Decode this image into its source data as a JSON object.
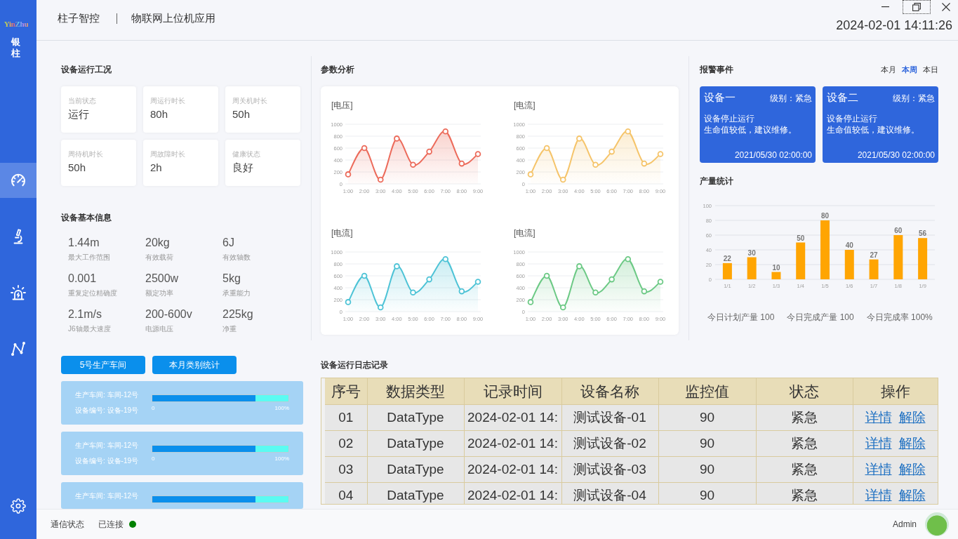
{
  "sidebar": {
    "logo": "YinZhu",
    "brand": "银柱",
    "nav": [
      {
        "kind": "gauge",
        "selected": true
      },
      {
        "kind": "microscope",
        "selected": false
      },
      {
        "kind": "siren",
        "selected": false
      },
      {
        "kind": "path",
        "selected": false
      }
    ]
  },
  "header": {
    "company": "柱子智控",
    "app_title": "物联网上位机应用",
    "datetime": "2024-02-01 14:11:26"
  },
  "window_controls": [
    {
      "kind": "minimize",
      "focused": false
    },
    {
      "kind": "restore",
      "focused": true
    },
    {
      "kind": "close",
      "focused": false
    }
  ],
  "status_panel": {
    "title": "设备运行工况",
    "cards": [
      {
        "label": "当前状态",
        "value": "运行"
      },
      {
        "label": "周运行时长",
        "value": "80h"
      },
      {
        "label": "周关机时长",
        "value": "50h"
      },
      {
        "label": "周待机时长",
        "value": "50h"
      },
      {
        "label": "周故障时长",
        "value": "2h"
      },
      {
        "label": "健康状态",
        "value": "良好"
      }
    ]
  },
  "basic_info": {
    "title": "设备基本信息",
    "items": [
      {
        "value": "1.44m",
        "label": "最大工作范围"
      },
      {
        "value": "20kg",
        "label": "有效载荷"
      },
      {
        "value": "6J",
        "label": "有效轴数"
      },
      {
        "value": "0.001",
        "label": "重复定位精确度"
      },
      {
        "value": "2500w",
        "label": "额定功率"
      },
      {
        "value": "5kg",
        "label": "承重能力"
      },
      {
        "value": "2.1m/s",
        "label": "J6轴最大速度"
      },
      {
        "value": "200-600v",
        "label": "电源电压"
      },
      {
        "value": "225kg",
        "label": "净重"
      }
    ]
  },
  "workshop": {
    "buttons": [
      "5号生产车间",
      "本月类别统计"
    ],
    "cards": [
      {
        "workshop": "生产车间: 车间-12号",
        "device": "设备编号: 设备-19号",
        "level": 0.76,
        "scale_min": "0",
        "scale_max": "100%"
      },
      {
        "workshop": "生产车间: 车间-12号",
        "device": "设备编号: 设备-19号",
        "level": 0.76,
        "scale_min": "0",
        "scale_max": "100%"
      },
      {
        "workshop": "生产车间: 车间-12号",
        "level": 0.76
      }
    ]
  },
  "parameters": {
    "title": "参数分析",
    "charts": [
      {
        "chart_data": {
          "type": "area",
          "title": "[电压]",
          "categories": [
            "1:00",
            "2:00",
            "3:00",
            "4:00",
            "5:00",
            "6:00",
            "7:00",
            "8:00",
            "9:00"
          ],
          "series": [
            {
              "color": "#ec6b5b",
              "values": [
                160,
                600,
                70,
                760,
                320,
                540,
                880,
                340,
                500
              ]
            }
          ],
          "ylim": [
            0,
            1000
          ],
          "yticks": [
            0,
            200,
            400,
            600,
            800,
            1000
          ],
          "grid": true
        }
      },
      {
        "chart_data": {
          "type": "area",
          "title": "[电流]",
          "categories": [
            "1:00",
            "2:00",
            "3:00",
            "4:00",
            "5:00",
            "6:00",
            "7:00",
            "8:00",
            "9:00"
          ],
          "series": [
            {
              "color": "#f5c46a",
              "values": [
                160,
                600,
                70,
                760,
                320,
                540,
                880,
                340,
                500
              ]
            }
          ],
          "ylim": [
            0,
            1000
          ],
          "yticks": [
            0,
            200,
            400,
            600,
            800,
            1000
          ],
          "grid": true
        }
      },
      {
        "chart_data": {
          "type": "area",
          "title": "[电流]",
          "categories": [
            "1:00",
            "2:00",
            "3:00",
            "4:00",
            "5:00",
            "6:00",
            "7:00",
            "8:00",
            "9:00"
          ],
          "series": [
            {
              "color": "#4ec3d6",
              "values": [
                160,
                600,
                70,
                760,
                320,
                540,
                880,
                340,
                500
              ]
            }
          ],
          "ylim": [
            0,
            1000
          ],
          "yticks": [
            0,
            200,
            400,
            600,
            800,
            1000
          ],
          "grid": true
        }
      },
      {
        "chart_data": {
          "type": "area",
          "title": "[电流]",
          "categories": [
            "1:00",
            "2:00",
            "3:00",
            "4:00",
            "5:00",
            "6:00",
            "7:00",
            "8:00",
            "9:00"
          ],
          "series": [
            {
              "color": "#6cc985",
              "values": [
                160,
                600,
                70,
                760,
                320,
                540,
                880,
                340,
                500
              ]
            }
          ],
          "ylim": [
            0,
            1000
          ],
          "yticks": [
            0,
            200,
            400,
            600,
            800,
            1000
          ],
          "grid": true
        }
      }
    ]
  },
  "alarms": {
    "title": "报警事件",
    "tabs": [
      {
        "label": "本月",
        "selected": false
      },
      {
        "label": "本周",
        "selected": true
      },
      {
        "label": "本日",
        "selected": false
      }
    ],
    "events": [
      {
        "device": "设备一",
        "severity": "级别：紧急",
        "lines": [
          "设备停止运行",
          "生命值较低，建议维修。"
        ],
        "time": "2021/05/30 02:00:00"
      },
      {
        "device": "设备二",
        "severity": "级别：紧急",
        "lines": [
          "设备停止运行",
          "生命值较低，建议维修。"
        ],
        "time": "2021/05/30 02:00:00"
      }
    ]
  },
  "production": {
    "chart_data": {
      "type": "bar",
      "title": "产量统计",
      "categories": [
        "1/1",
        "1/2",
        "1/3",
        "1/4",
        "1/5",
        "1/6",
        "1/7",
        "1/8",
        "1/9"
      ],
      "series": [
        {
          "color": "#ffa502",
          "values": [
            22,
            30,
            10,
            50,
            80,
            40,
            27,
            60,
            56
          ]
        }
      ],
      "ylim": [
        0,
        100
      ],
      "yticks": [
        0,
        20,
        40,
        60,
        80,
        100
      ],
      "grid": true,
      "data_labels": true
    },
    "stats": [
      "今日计划产量 100",
      "今日完成产量 100",
      "今日完成率 100%"
    ]
  },
  "log_table": {
    "title": "设备运行日志记录",
    "columns": [
      "序号",
      "数据类型",
      "记录时间",
      "设备名称",
      "监控值",
      "状态",
      "操作"
    ],
    "rows": [
      {
        "cells": [
          "01",
          "DataType",
          "2024-02-01 14:",
          "测试设备-01",
          "90",
          "紧急"
        ],
        "actions": [
          "详情",
          "解除"
        ]
      },
      {
        "cells": [
          "02",
          "DataType",
          "2024-02-01 14:",
          "测试设备-02",
          "90",
          "紧急"
        ],
        "actions": [
          "详情",
          "解除"
        ]
      },
      {
        "cells": [
          "03",
          "DataType",
          "2024-02-01 14:",
          "测试设备-03",
          "90",
          "紧急"
        ],
        "actions": [
          "详情",
          "解除"
        ]
      },
      {
        "cells": [
          "04",
          "DataType",
          "2024-02-01 14:",
          "测试设备-04",
          "90",
          "紧急"
        ],
        "actions": [
          "详情",
          "解除"
        ]
      }
    ]
  },
  "status_bar": {
    "label": "通信状态",
    "value": "已连接",
    "connected": true,
    "user": "Admin"
  }
}
